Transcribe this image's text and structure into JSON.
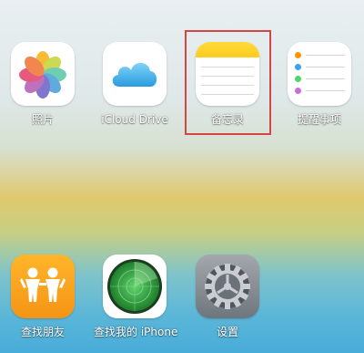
{
  "apps_row1": [
    {
      "label": "照片"
    },
    {
      "label": "iCloud Drive"
    },
    {
      "label": "备忘录"
    },
    {
      "label": "提醒事项"
    }
  ],
  "apps_row2": [
    {
      "label": "查找朋友"
    },
    {
      "label": "查找我的 iPhone"
    },
    {
      "label": "设置"
    }
  ],
  "colors": {
    "highlight": "#d64545",
    "notes_yellow": "#ffd42e",
    "find_friends_orange": "#f8a21a",
    "find_iphone_green": "#2f9a3e"
  },
  "icons": {
    "photos": "photos-icon",
    "icloud": "icloud-drive-icon",
    "notes": "notes-icon",
    "reminders": "reminders-icon",
    "find_friends": "find-friends-icon",
    "find_iphone": "find-my-iphone-icon",
    "settings": "settings-icon"
  }
}
